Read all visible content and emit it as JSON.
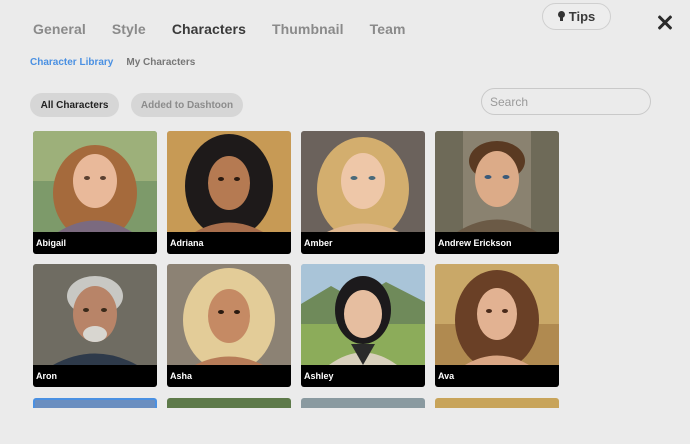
{
  "tabs": [
    {
      "label": "General",
      "active": false
    },
    {
      "label": "Style",
      "active": false
    },
    {
      "label": "Characters",
      "active": true
    },
    {
      "label": "Thumbnail",
      "active": false
    },
    {
      "label": "Team",
      "active": false
    }
  ],
  "tips_label": "Tips",
  "subtabs": [
    {
      "label": "Character Library",
      "active": true
    },
    {
      "label": "My Characters",
      "active": false
    }
  ],
  "filters": [
    {
      "label": "All Characters",
      "active": true
    },
    {
      "label": "Added to Dashtoon",
      "active": false
    }
  ],
  "search": {
    "placeholder": "Search",
    "value": ""
  },
  "characters": [
    {
      "name": "Abigail"
    },
    {
      "name": "Adriana"
    },
    {
      "name": "Amber"
    },
    {
      "name": "Andrew Erickson"
    },
    {
      "name": "Aron"
    },
    {
      "name": "Asha"
    },
    {
      "name": "Ashley"
    },
    {
      "name": "Ava"
    }
  ],
  "icons": {
    "tips": "lightbulb-icon",
    "close": "close-icon"
  }
}
